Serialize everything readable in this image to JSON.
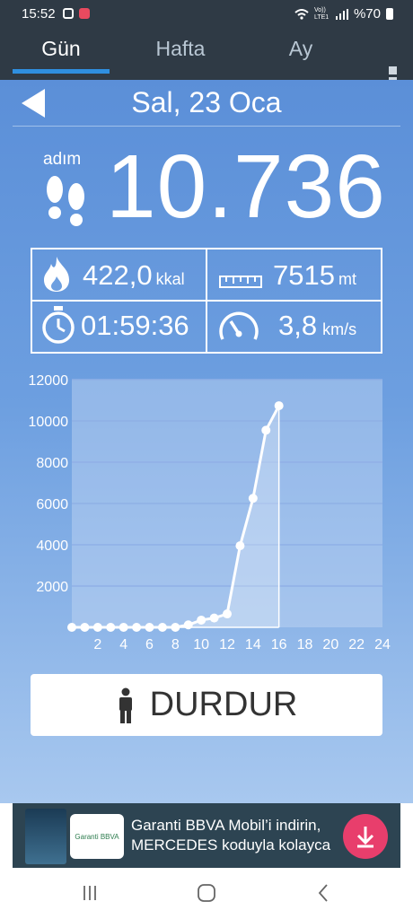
{
  "status_bar": {
    "time": "15:52",
    "network": "Vo)) LTE1",
    "battery": "%70"
  },
  "tabs": [
    {
      "label": "Gün",
      "active": true
    },
    {
      "label": "Hafta",
      "active": false
    },
    {
      "label": "Ay",
      "active": false
    }
  ],
  "header": {
    "date": "Sal, 23 Oca"
  },
  "steps": {
    "label": "adım",
    "value": "10.736"
  },
  "stats": {
    "calories": {
      "value": "422,0",
      "unit": "kkal"
    },
    "distance": {
      "value": "7515",
      "unit": "mt"
    },
    "duration": {
      "value": "01:59:36"
    },
    "speed": {
      "value": "3,8",
      "unit": "km/s"
    }
  },
  "chart_data": {
    "type": "area",
    "x": [
      0,
      1,
      2,
      3,
      4,
      5,
      6,
      7,
      8,
      9,
      10,
      11,
      12,
      13,
      14,
      15,
      16
    ],
    "values": [
      0,
      0,
      0,
      0,
      0,
      0,
      0,
      0,
      0,
      120,
      350,
      450,
      650,
      3950,
      6250,
      9550,
      10736
    ],
    "xticks": [
      "2",
      "4",
      "6",
      "8",
      "10",
      "12",
      "14",
      "16",
      "18",
      "20",
      "22",
      "24"
    ],
    "yticks": [
      "2000",
      "4000",
      "6000",
      "8000",
      "10000",
      "12000"
    ],
    "xlim": [
      0,
      24
    ],
    "ylim": [
      0,
      12000
    ],
    "grid": true,
    "colors": {
      "line": "#ffffff",
      "grid": "#8fb0e6",
      "plot_bg": "#c3d8f3"
    }
  },
  "stop_button": {
    "label": "DURDUR"
  },
  "ad": {
    "line1": "Garanti BBVA Mobil’i indirin,",
    "line2": "MERCEDES koduyla kolayca",
    "logo": "Garanti BBVA"
  },
  "colors": {
    "header_bg": "#2f3a45",
    "tab_active": "#2f8fe0",
    "accent_pink": "#e83e6c"
  }
}
